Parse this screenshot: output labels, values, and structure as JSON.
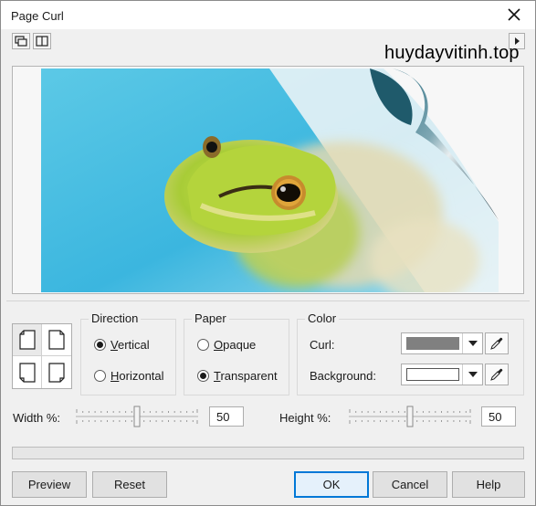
{
  "window": {
    "title": "Page Curl"
  },
  "icons": {
    "close": "close-icon",
    "single_preview": "single-preview-icon",
    "dual_preview": "dual-preview-icon",
    "expand": "expand-arrow-icon",
    "eyedropper": "eyedropper-icon",
    "dropdown": "chevron-down-icon"
  },
  "watermark": "huydayvitinh.top",
  "direction": {
    "label": "Direction",
    "options": [
      {
        "label": "Vertical",
        "accel": "V",
        "rest": "ertical",
        "checked": true
      },
      {
        "label": "Horizontal",
        "accel": "H",
        "rest": "orizontal",
        "checked": false
      }
    ]
  },
  "paper": {
    "label": "Paper",
    "options": [
      {
        "label": "Opaque",
        "accel": "O",
        "rest": "paque",
        "checked": false
      },
      {
        "label": "Transparent",
        "accel": "T",
        "rest": "ransparent",
        "checked": true
      }
    ]
  },
  "color": {
    "label": "Color",
    "curl_label": "Curl:",
    "background_label": "Background:",
    "curl_value": "#808080",
    "background_value": "#ffffff"
  },
  "width": {
    "label": "Width %:",
    "value": "50"
  },
  "height": {
    "label": "Height %:",
    "value": "50"
  },
  "buttons": {
    "preview": "Preview",
    "reset": "Reset",
    "ok": "OK",
    "cancel": "Cancel",
    "help": "Help"
  }
}
